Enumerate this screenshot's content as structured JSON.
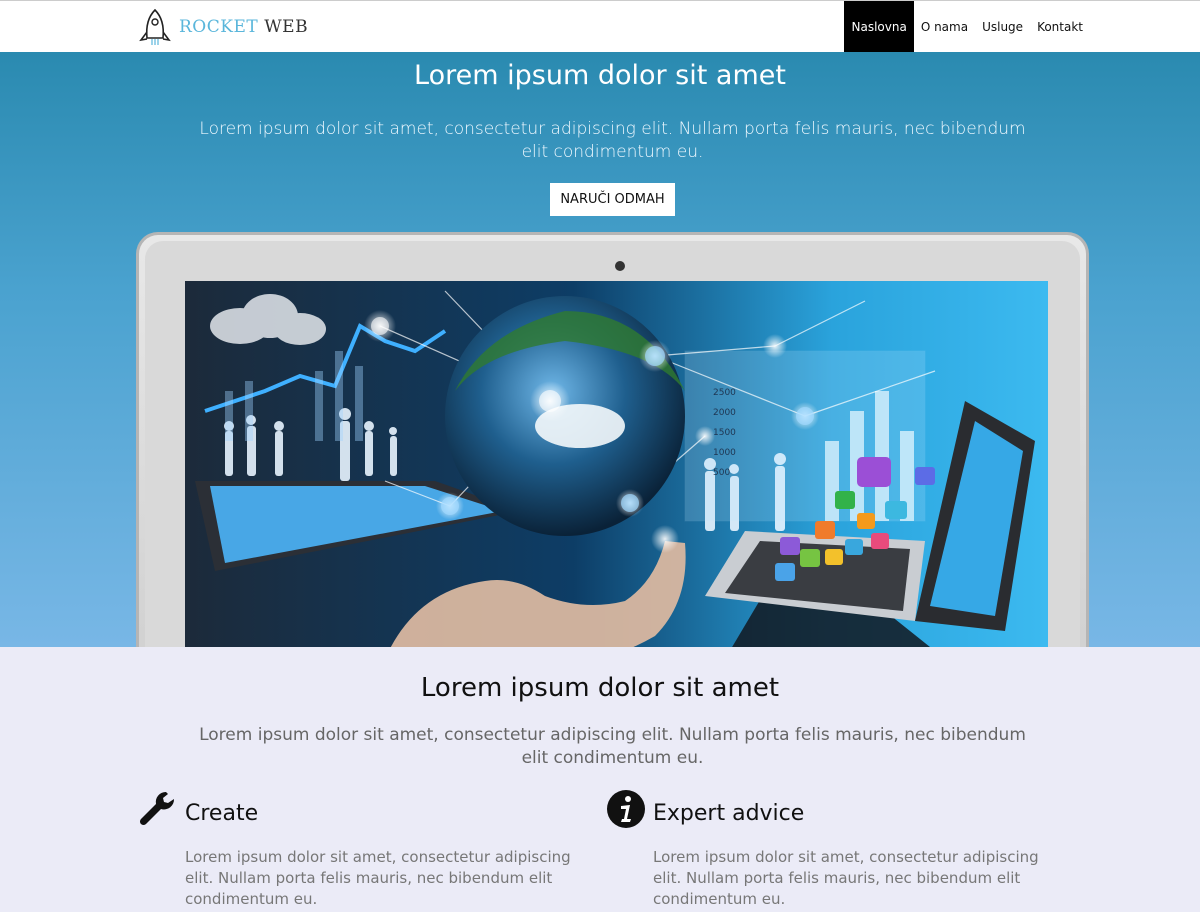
{
  "brand": {
    "rocket": "ROCKET",
    "web": "WEB"
  },
  "nav": {
    "items": [
      {
        "label": "Naslovna",
        "active": true
      },
      {
        "label": "O nama",
        "active": false
      },
      {
        "label": "Usluge",
        "active": false
      },
      {
        "label": "Kontakt",
        "active": false
      }
    ]
  },
  "hero": {
    "title": "Lorem ipsum dolor sit amet",
    "subtitle": "Lorem ipsum dolor sit amet, consectetur adipiscing elit. Nullam porta felis mauris, nec bibendum elit condimentum eu.",
    "cta_label": "NARUČI ODMAH",
    "screen_labels": [
      "2500",
      "2000",
      "1500",
      "1000",
      "500"
    ]
  },
  "features": {
    "title": "Lorem ipsum dolor sit amet",
    "subtitle": "Lorem ipsum dolor sit amet, consectetur adipiscing elit. Nullam porta felis mauris, nec bibendum elit condimentum eu.",
    "items": [
      {
        "icon": "wrench-icon",
        "heading": "Create",
        "text": "Lorem ipsum dolor sit amet, consectetur adipiscing elit. Nullam porta felis mauris, nec bibendum elit condimentum eu."
      },
      {
        "icon": "info-icon",
        "heading": "Expert advice",
        "text": "Lorem ipsum dolor sit amet, consectetur adipiscing elit. Nullam porta felis mauris, nec bibendum elit condimentum eu."
      }
    ]
  },
  "colors": {
    "accent": "#5ab6db",
    "nav_active_bg": "#000000",
    "hero_top": "#2a8ab0",
    "hero_bottom": "#78b7e6",
    "section_bg": "#ebebf7"
  }
}
